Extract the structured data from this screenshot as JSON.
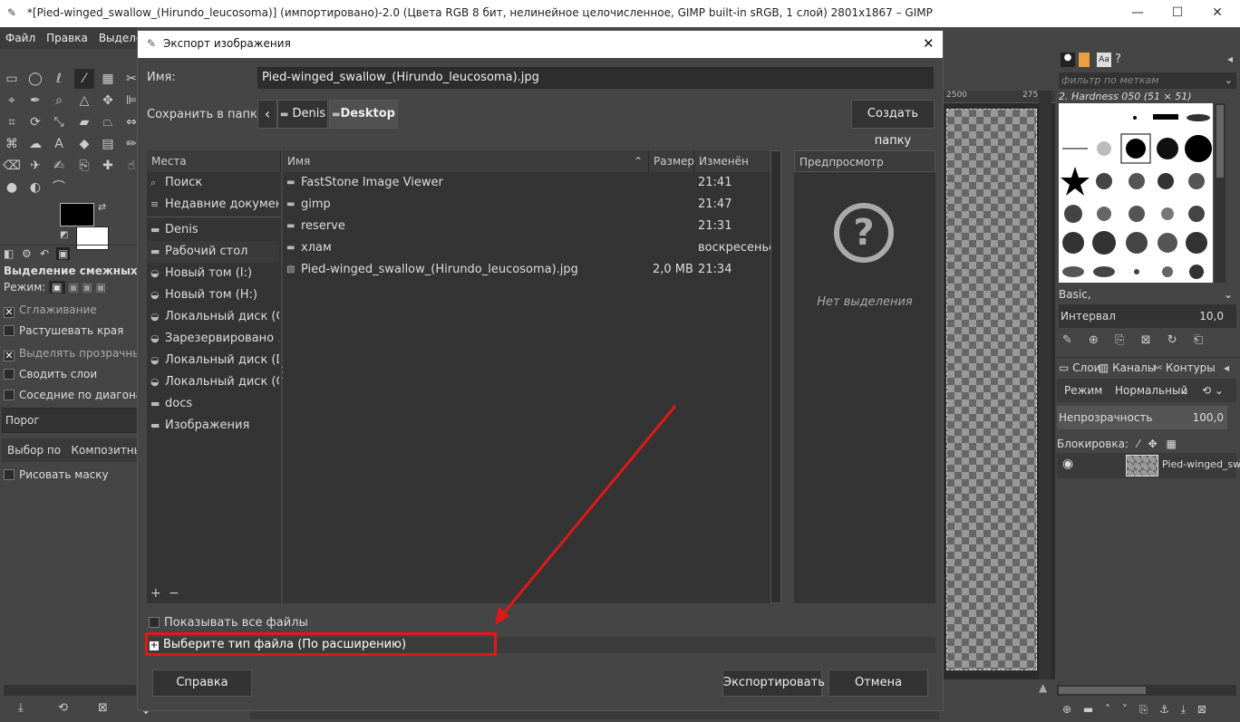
{
  "window": {
    "title": "*[Pied-winged_swallow_(Hirundo_leucosoma)] (импортировано)-2.0 (Цвета RGB 8 бит, нелинейное целочисленное, GIMP built-in sRGB, 1 слой) 2801x1867 – GIMP",
    "min": "—",
    "max": "☐",
    "close": "✕"
  },
  "menu": {
    "file": "Файл",
    "edit": "Правка",
    "select": "Выделени"
  },
  "tool_options": {
    "title": "Выделение смежных обл",
    "mode_label": "Режим:",
    "antialias": "Сглаживание",
    "feather": "Растушевать края",
    "select_transparent": "Выделять прозрачные об",
    "sample_merged": "Сводить слои",
    "diagonal": "Соседние по диагонали",
    "threshold": "Порог",
    "select_by": "Выбор по",
    "composite": "Композитный ц",
    "draw_mask": "Рисовать маску"
  },
  "ruler": {
    "mark_2500": "2500",
    "mark_275": "275"
  },
  "brushes": {
    "filter_placeholder": "фильтр по меткам",
    "current": "2. Hardness 050 (51 × 51)",
    "preset": "Basic,",
    "spacing_label": "Интервал",
    "spacing_value": "10,0"
  },
  "layers": {
    "tab_layers": "Слои",
    "tab_channels": "Каналы",
    "tab_paths": "Контуры",
    "mode_label": "Режим",
    "mode_value": "Нормальный",
    "opacity_label": "Непрозрачность",
    "opacity_value": "100,0",
    "lock_label": "Блокировка:",
    "layer_name": "Pied-winged_swa"
  },
  "dialog": {
    "title": "Экспорт изображения",
    "name_label": "Имя:",
    "name_value": "Pied-winged_swallow_(Hirundo_leucosoma).jpg",
    "save_in_label": "Сохранить в папке",
    "crumb_back": "‹",
    "crumb_1": "Denis",
    "crumb_2": "Desktop",
    "create_folder": "Создать папку",
    "places_header": "Места",
    "places": [
      {
        "icon": "search-icon",
        "glyph": "⌕",
        "label": "Поиск"
      },
      {
        "icon": "recent-icon",
        "glyph": "≡",
        "label": "Недавние докумен..."
      },
      {
        "icon": "folder-icon",
        "glyph": "▬",
        "label": "Denis"
      },
      {
        "icon": "folder-icon",
        "glyph": "▬",
        "label": "Рабочий стол"
      },
      {
        "icon": "drive-icon",
        "glyph": "◒",
        "label": "Новый том (I:)"
      },
      {
        "icon": "drive-icon",
        "glyph": "◒",
        "label": "Новый том (H:)"
      },
      {
        "icon": "drive-icon",
        "glyph": "◒",
        "label": "Локальный диск (G:)"
      },
      {
        "icon": "drive-icon",
        "glyph": "◒",
        "label": "Зарезервировано ..."
      },
      {
        "icon": "drive-icon",
        "glyph": "◒",
        "label": "Локальный диск (D:)"
      },
      {
        "icon": "drive-icon",
        "glyph": "◒",
        "label": "Локальный диск (C:)"
      },
      {
        "icon": "folder-icon",
        "glyph": "▬",
        "label": "docs"
      },
      {
        "icon": "folder-icon",
        "glyph": "▬",
        "label": "Изображения"
      }
    ],
    "places_add": "+",
    "places_remove": "−",
    "col_name": "Имя",
    "col_size": "Размер",
    "col_modified": "Изменён",
    "files": [
      {
        "icon": "folder-icon",
        "name": "FastStone Image Viewer",
        "size": "",
        "modified": "21:41"
      },
      {
        "icon": "folder-icon",
        "name": "gimp",
        "size": "",
        "modified": "21:47"
      },
      {
        "icon": "folder-icon",
        "name": "reserve",
        "size": "",
        "modified": "21:31"
      },
      {
        "icon": "folder-icon",
        "name": "хлам",
        "size": "",
        "modified": "воскресенье"
      },
      {
        "icon": "image-file-icon",
        "name": "Pied-winged_swallow_(Hirundo_leucosoma).jpg",
        "size": "2,0 MB",
        "modified": "21:34"
      }
    ],
    "preview_header": "Предпросмотр",
    "preview_empty": "Нет выделения",
    "show_all_files": "Показывать все файлы",
    "file_type": "Выберите тип файла (По расширению)",
    "help": "Справка",
    "export": "Экспортировать",
    "cancel": "Отмена"
  },
  "colors": {
    "annotation_red": "#e01818",
    "selected_place": "#3a3a3a"
  }
}
